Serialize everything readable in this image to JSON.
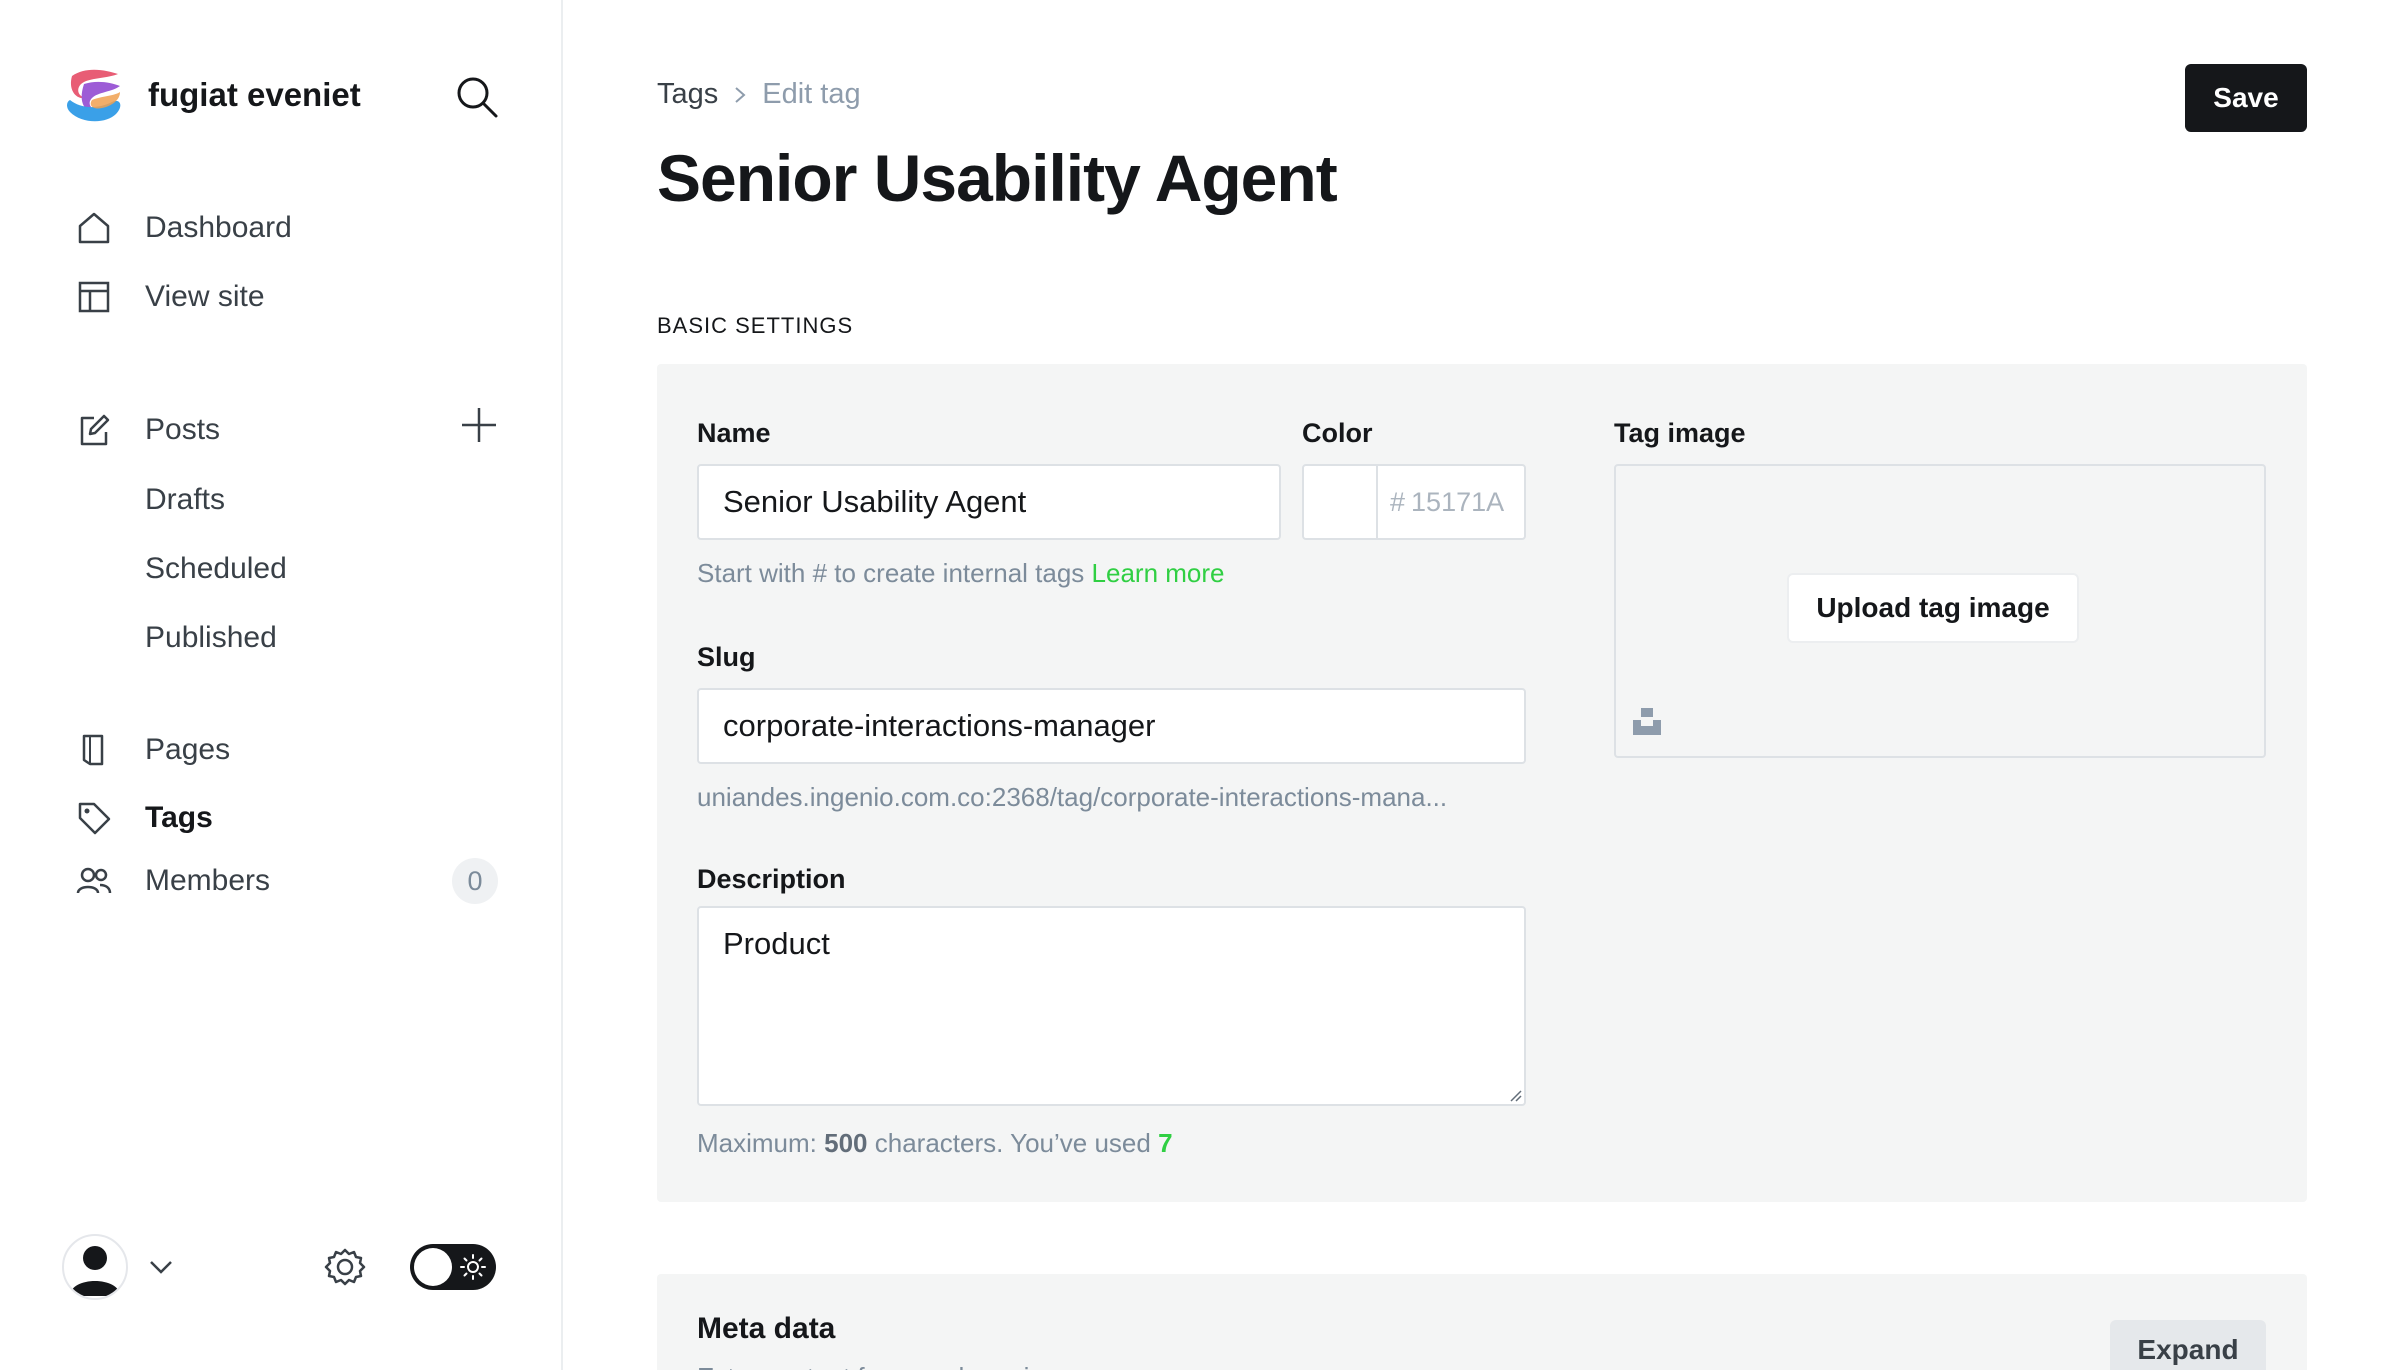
{
  "sidebar": {
    "site_name": "fugiat eveniet",
    "nav_primary": [
      {
        "label": "Dashboard",
        "icon": "home-icon"
      },
      {
        "label": "View site",
        "icon": "layout-icon"
      }
    ],
    "posts": {
      "label": "Posts",
      "icon": "edit-icon",
      "sub_items": [
        {
          "label": "Drafts"
        },
        {
          "label": "Scheduled"
        },
        {
          "label": "Published"
        }
      ]
    },
    "nav_secondary": [
      {
        "label": "Pages",
        "icon": "page-icon"
      },
      {
        "label": "Tags",
        "icon": "tag-icon",
        "active": true
      },
      {
        "label": "Members",
        "icon": "members-icon",
        "count": "0"
      }
    ]
  },
  "header": {
    "breadcrumb_parent": "Tags",
    "breadcrumb_current": "Edit tag",
    "title": "Senior Usability Agent",
    "save_label": "Save"
  },
  "basic_settings": {
    "section_label": "BASIC SETTINGS",
    "name_label": "Name",
    "name_value": "Senior Usability Agent",
    "name_hint": "Start with # to create internal tags",
    "name_hint_link": "Learn more",
    "color_label": "Color",
    "color_prefix": "#",
    "color_placeholder": "15171A",
    "slug_label": "Slug",
    "slug_value": "corporate-interactions-manager",
    "slug_url": "uniandes.ingenio.com.co:2368/tag/corporate-interactions-mana...",
    "description_label": "Description",
    "description_value": "Product",
    "description_hint_prefix": "Maximum:",
    "description_max": "500",
    "description_hint_mid": "characters. You’ve used",
    "description_used": "7",
    "tag_image_label": "Tag image",
    "upload_label": "Upload tag image"
  },
  "meta": {
    "title": "Meta data",
    "subtitle": "Extra content for search engines",
    "expand_label": "Expand"
  },
  "colors": {
    "accent_green": "#30cf43",
    "primary_dark": "#15171a",
    "panel_bg": "#f4f5f5"
  }
}
